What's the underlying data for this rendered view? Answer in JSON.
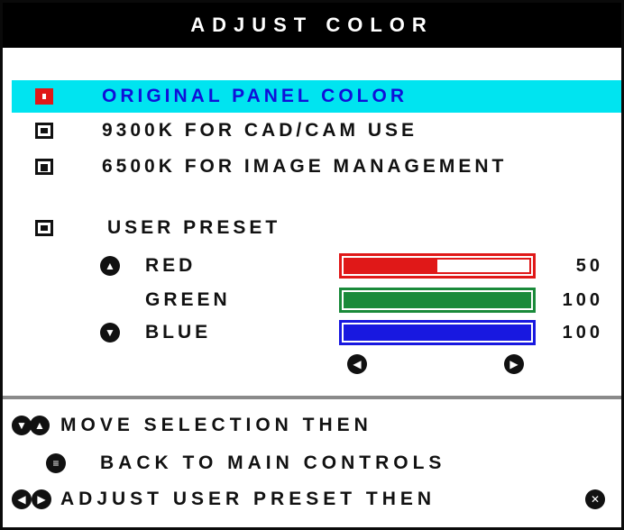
{
  "title": "ADJUST COLOR",
  "options": [
    {
      "label": "ORIGINAL PANEL COLOR",
      "selected": true
    },
    {
      "label": "9300K FOR CAD/CAM USE",
      "selected": false
    },
    {
      "label": "6500K FOR IMAGE MANAGEMENT",
      "selected": false
    }
  ],
  "user_preset": {
    "label": "USER PRESET",
    "channels": [
      {
        "label": "RED",
        "value": "50",
        "level_percent": 50,
        "color": "#e01818"
      },
      {
        "label": "GREEN",
        "value": "100",
        "level_percent": 100,
        "color": "#1a8a3a"
      },
      {
        "label": "BLUE",
        "value": "100",
        "level_percent": 100,
        "color": "#1818e0"
      }
    ]
  },
  "help": [
    "MOVE SELECTION THEN",
    "BACK TO MAIN CONTROLS",
    "ADJUST USER PRESET THEN"
  ],
  "icons": {
    "up": "up-arrow-circle-icon",
    "down": "down-arrow-circle-icon",
    "left": "left-arrow-circle-icon",
    "right": "right-arrow-circle-icon",
    "menu": "menu-circle-icon",
    "close": "close-circle-icon"
  },
  "colors": {
    "highlight_bg": "#00e4f0",
    "highlight_text": "#1010d8",
    "titlebar_bg": "#000000"
  }
}
